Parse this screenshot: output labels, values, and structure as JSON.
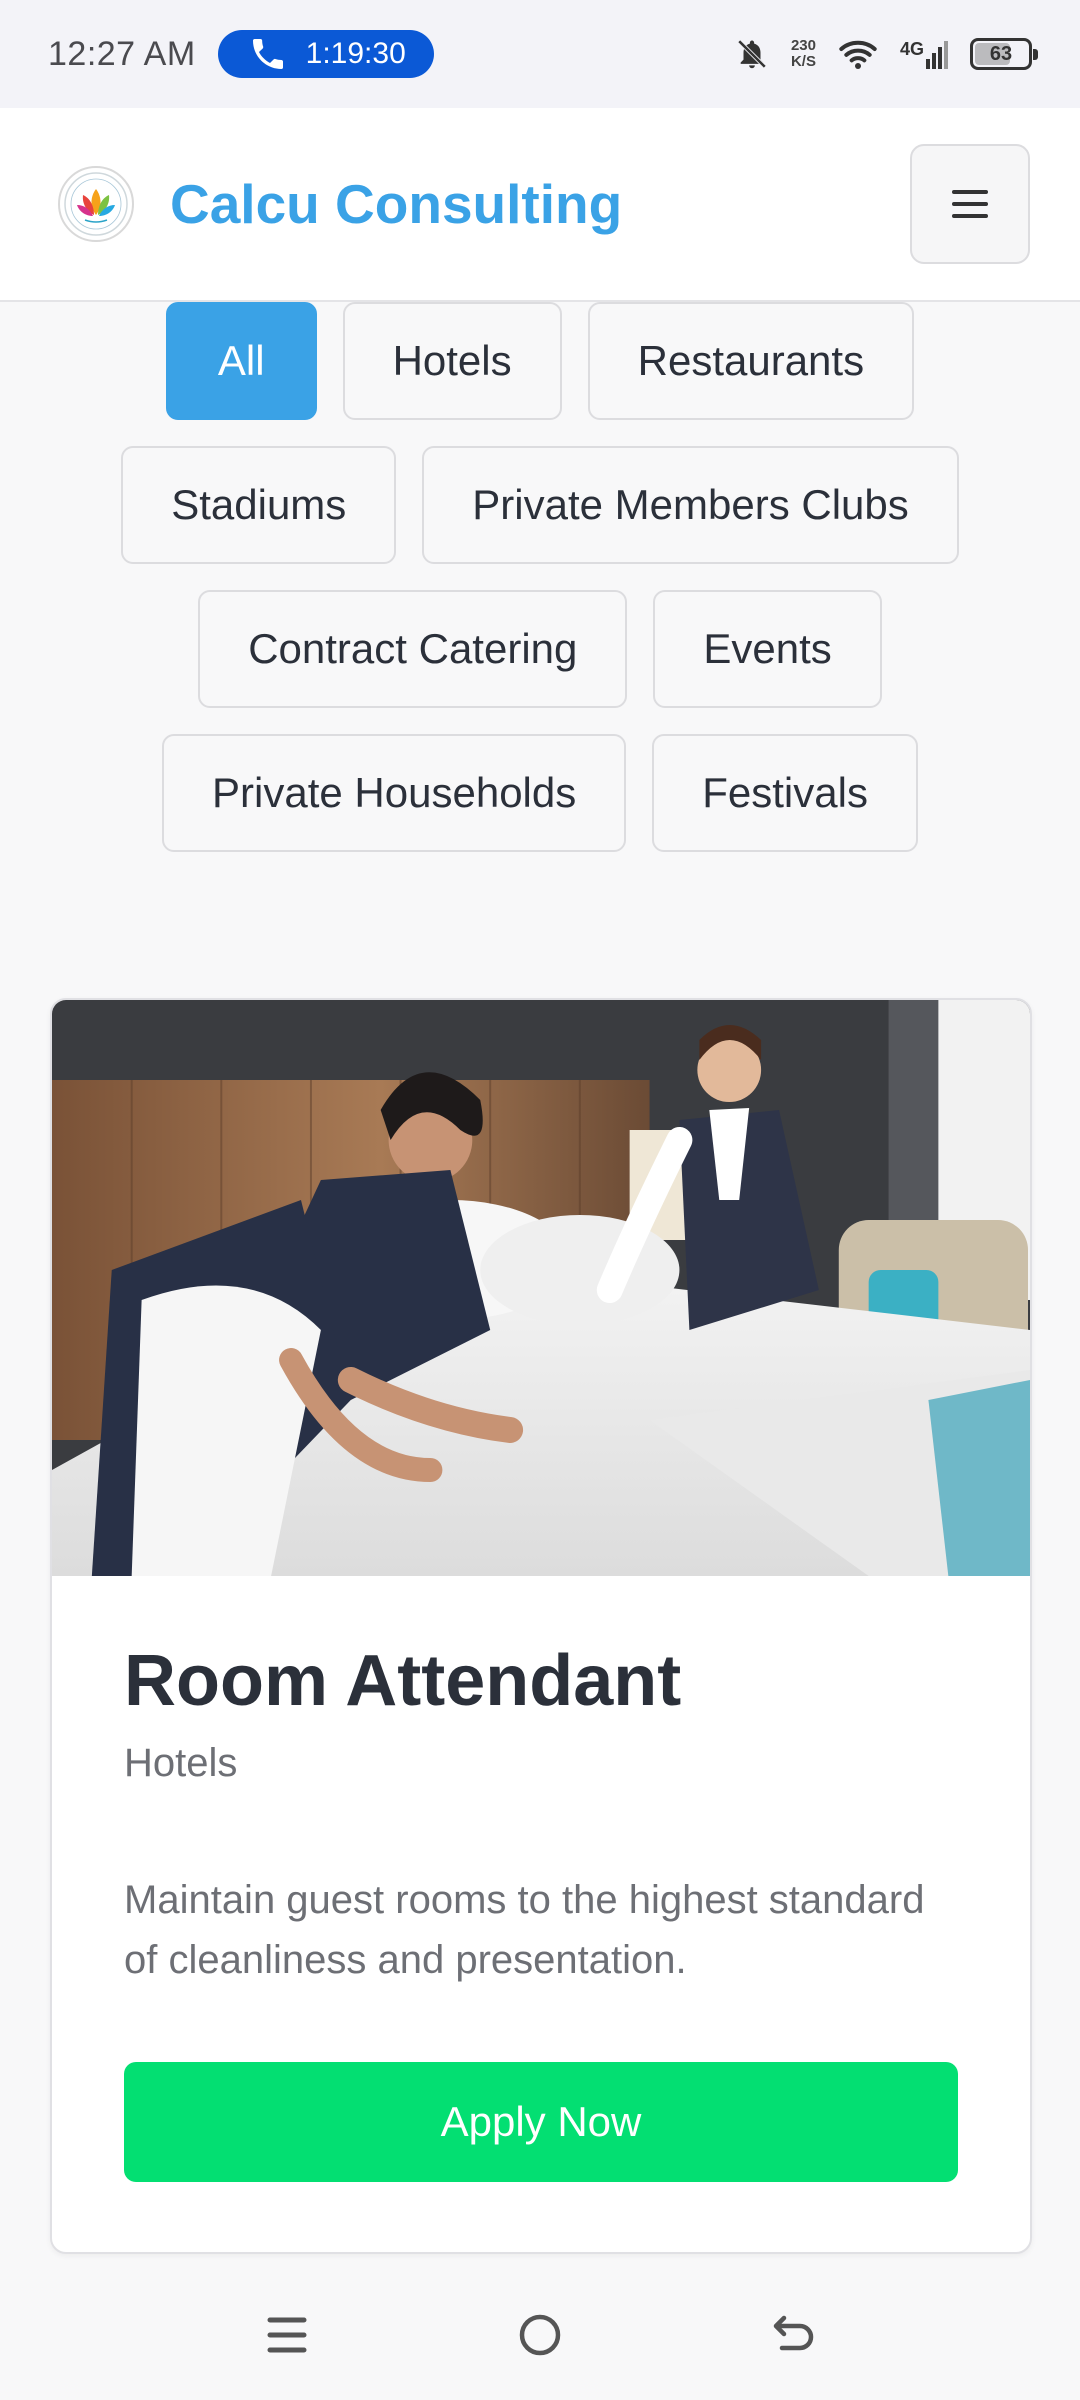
{
  "status_bar": {
    "time": "12:27 AM",
    "call_duration": "1:19:30",
    "net_speed_value": "230",
    "net_speed_unit": "K/S",
    "network_type": "4G",
    "battery_level": "63",
    "icons": [
      "phone-icon",
      "bell-muted-icon",
      "wifi-icon",
      "signal-icon",
      "battery-icon"
    ]
  },
  "header": {
    "brand_name": "Calcu Consulting",
    "brand_color": "#3aa2e6",
    "menu_icon": "hamburger-icon"
  },
  "filters": {
    "active": "All",
    "active_color": "#3aa2e6",
    "rows": [
      [
        "All",
        "Hotels",
        "Restaurants"
      ],
      [
        "Stadiums",
        "Private Members Clubs"
      ],
      [
        "Contract Catering",
        "Events"
      ],
      [
        "Private Households",
        "Festivals"
      ]
    ]
  },
  "job": {
    "image_alt": "Two housekeepers making a hotel bed",
    "title": "Room Attendant",
    "category": "Hotels",
    "description": "Maintain guest rooms to the highest standard of cleanliness and presentation.",
    "apply_label": "Apply Now",
    "apply_color": "#03df72"
  },
  "nav_bar": {
    "icons": [
      "recents-icon",
      "home-icon",
      "back-icon"
    ]
  }
}
